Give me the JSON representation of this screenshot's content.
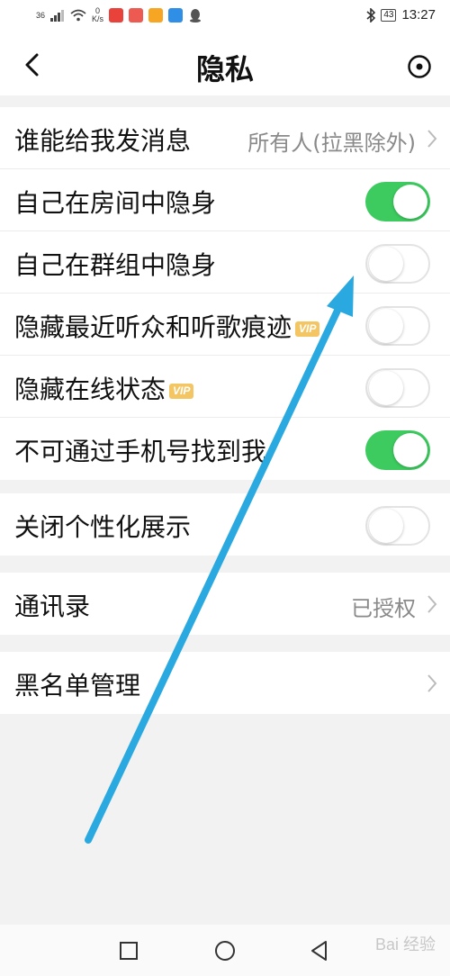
{
  "status_bar": {
    "signal": "36",
    "speed": "0",
    "speed_unit": "K/s",
    "time": "13:27",
    "battery": "43"
  },
  "header": {
    "title": "隐私"
  },
  "groups": {
    "main": {
      "message_who": {
        "label": "谁能给我发消息",
        "value": "所有人(拉黑除外)"
      },
      "invisible_room": {
        "label": "自己在房间中隐身",
        "toggle": "on"
      },
      "invisible_group": {
        "label": "自己在群组中隐身",
        "toggle": "off"
      },
      "hide_listeners": {
        "label": "隐藏最近听众和听歌痕迹",
        "badge": "VIP",
        "toggle": "off"
      },
      "hide_online": {
        "label": "隐藏在线状态",
        "badge": "VIP",
        "toggle": "off"
      },
      "phone_search": {
        "label": "不可通过手机号找到我",
        "toggle": "on"
      }
    },
    "personalization": {
      "label": "关闭个性化展示",
      "toggle": "off"
    },
    "contacts": {
      "label": "通讯录",
      "value": "已授权"
    },
    "blacklist": {
      "label": "黑名单管理"
    }
  },
  "colors": {
    "toggle_on": "#3dcb5f",
    "vip_badge": "#f4c563",
    "annotation_arrow": "#29a9e0"
  },
  "watermark": "Bai 经验"
}
